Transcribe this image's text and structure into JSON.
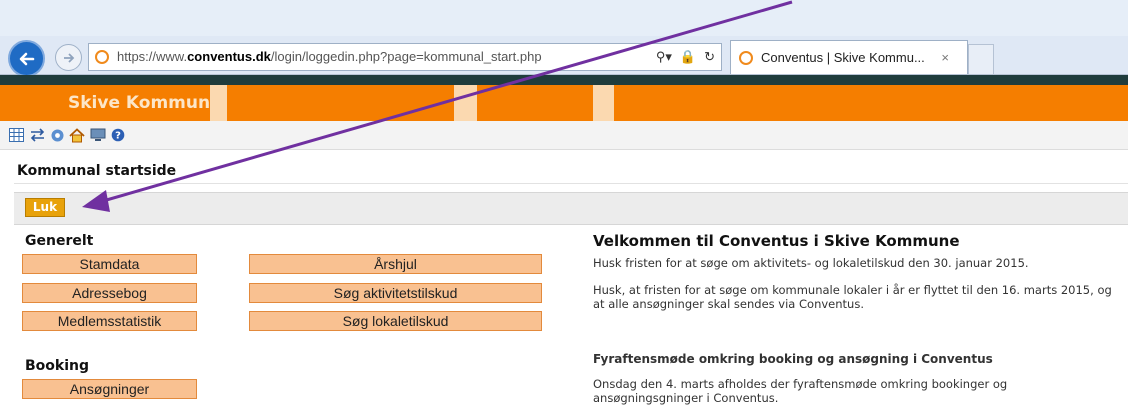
{
  "browser": {
    "url_prefix": "https://www.",
    "url_domain": "conventus.dk",
    "url_path": "/login/loggedin.php?page=kommunal_start.php",
    "tab_title": "Conventus | Skive Kommu...",
    "tab_close": "×",
    "icons": {
      "back": "back-arrow-icon",
      "forward": "forward-arrow-icon",
      "search": "search-icon",
      "lock": "lock-icon",
      "refresh": "refresh-icon"
    }
  },
  "site": {
    "title": "Skive Kommune",
    "colors": {
      "header": "#f57e00",
      "button": "#f9c191",
      "luk": "#e8a20b",
      "annotation": "#7030a0"
    }
  },
  "toolbar": {
    "icons": [
      "calendar-grid-icon",
      "transfer-arrows-icon",
      "settings-gear-icon",
      "home-icon",
      "computer-icon",
      "help-icon"
    ]
  },
  "page": {
    "title": "Kommunal startside",
    "close_button": "Luk"
  },
  "generelt": {
    "heading": "Generelt",
    "col1": [
      "Stamdata",
      "Adressebog",
      "Medlemsstatistik"
    ],
    "col2": [
      "Årshjul",
      "Søg aktivitetstilskud",
      "Søg lokaletilskud"
    ]
  },
  "booking": {
    "heading": "Booking",
    "items": [
      "Ansøgninger"
    ]
  },
  "welcome": {
    "heading": "Velkommen til Conventus i Skive Kommune",
    "p1": "Husk fristen for at søge om aktivitets- og lokaletilskud den 30. januar 2015.",
    "p2": "Husk, at fristen for at søge om kommunale lokaler i år er flyttet til den 16. marts 2015, og at alle ansøgninger skal sendes via Conventus.",
    "news_heading": "Fyraftensmøde omkring booking og ansøgning i Conventus",
    "p3": "Onsdag den 4. marts afholdes der fyraftensmøde omkring bookinger og ansøgningsgninger i Conventus."
  }
}
